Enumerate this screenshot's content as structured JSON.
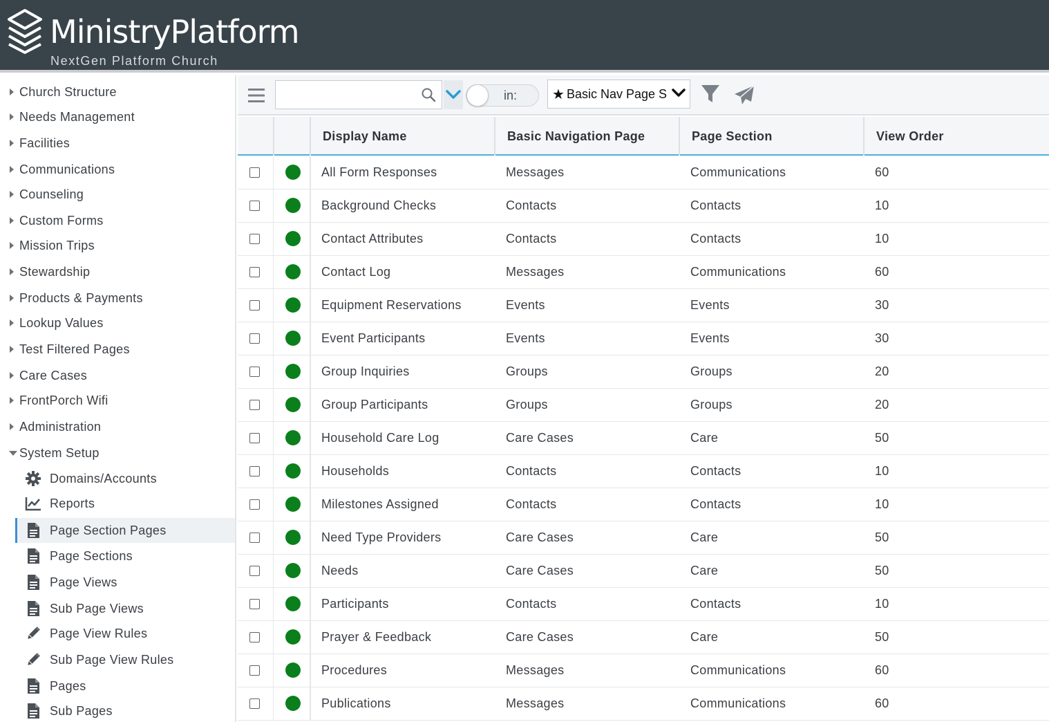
{
  "header": {
    "brand": "MinistryPlatform",
    "church": "NextGen Platform Church"
  },
  "sidebar": {
    "items": [
      {
        "label": "Church Structure"
      },
      {
        "label": "Needs Management"
      },
      {
        "label": "Facilities"
      },
      {
        "label": "Communications"
      },
      {
        "label": "Counseling"
      },
      {
        "label": "Custom Forms"
      },
      {
        "label": "Mission Trips"
      },
      {
        "label": "Stewardship"
      },
      {
        "label": "Products & Payments"
      },
      {
        "label": "Lookup Values"
      },
      {
        "label": "Test Filtered Pages"
      },
      {
        "label": "Care Cases"
      },
      {
        "label": "FrontPorch Wifi"
      },
      {
        "label": "Administration"
      },
      {
        "label": "System Setup"
      }
    ],
    "sub_items": [
      {
        "label": "Domains/Accounts",
        "icon": "gear-icon"
      },
      {
        "label": "Reports",
        "icon": "chart-icon"
      },
      {
        "label": "Page Section Pages",
        "icon": "document-icon"
      },
      {
        "label": "Page Sections",
        "icon": "document-icon"
      },
      {
        "label": "Page Views",
        "icon": "document-icon"
      },
      {
        "label": "Sub Page Views",
        "icon": "document-icon"
      },
      {
        "label": "Page View Rules",
        "icon": "pencil-icon"
      },
      {
        "label": "Sub Page View Rules",
        "icon": "pencil-icon"
      },
      {
        "label": "Pages",
        "icon": "document-icon"
      },
      {
        "label": "Sub Pages",
        "icon": "document-icon"
      }
    ],
    "active_sub_item": "Page Section Pages"
  },
  "toolbar": {
    "search_placeholder": "",
    "search_value": "",
    "toggle_label": "in:",
    "view_star": "★",
    "view_selected": "Basic Nav Page S"
  },
  "table": {
    "columns": [
      "Display Name",
      "Basic Navigation Page",
      "Page Section",
      "View Order"
    ],
    "rows": [
      [
        "All Form Responses",
        "Messages",
        "Communications",
        "60"
      ],
      [
        "Background Checks",
        "Contacts",
        "Contacts",
        "10"
      ],
      [
        "Contact Attributes",
        "Contacts",
        "Contacts",
        "10"
      ],
      [
        "Contact Log",
        "Messages",
        "Communications",
        "60"
      ],
      [
        "Equipment Reservations",
        "Events",
        "Events",
        "30"
      ],
      [
        "Event Participants",
        "Events",
        "Events",
        "30"
      ],
      [
        "Group Inquiries",
        "Groups",
        "Groups",
        "20"
      ],
      [
        "Group Participants",
        "Groups",
        "Groups",
        "20"
      ],
      [
        "Household Care Log",
        "Care Cases",
        "Care",
        "50"
      ],
      [
        "Households",
        "Contacts",
        "Contacts",
        "10"
      ],
      [
        "Milestones Assigned",
        "Contacts",
        "Contacts",
        "10"
      ],
      [
        "Need Type Providers",
        "Care Cases",
        "Care",
        "50"
      ],
      [
        "Needs",
        "Care Cases",
        "Care",
        "50"
      ],
      [
        "Participants",
        "Contacts",
        "Contacts",
        "10"
      ],
      [
        "Prayer & Feedback",
        "Care Cases",
        "Care",
        "50"
      ],
      [
        "Procedures",
        "Messages",
        "Communications",
        "60"
      ],
      [
        "Publications",
        "Messages",
        "Communications",
        "60"
      ]
    ]
  },
  "colors": {
    "header_bg": "#39434a",
    "status_active": "#0a7f1c",
    "accent": "#4ab0de",
    "selected_border": "#3a8fd3"
  }
}
